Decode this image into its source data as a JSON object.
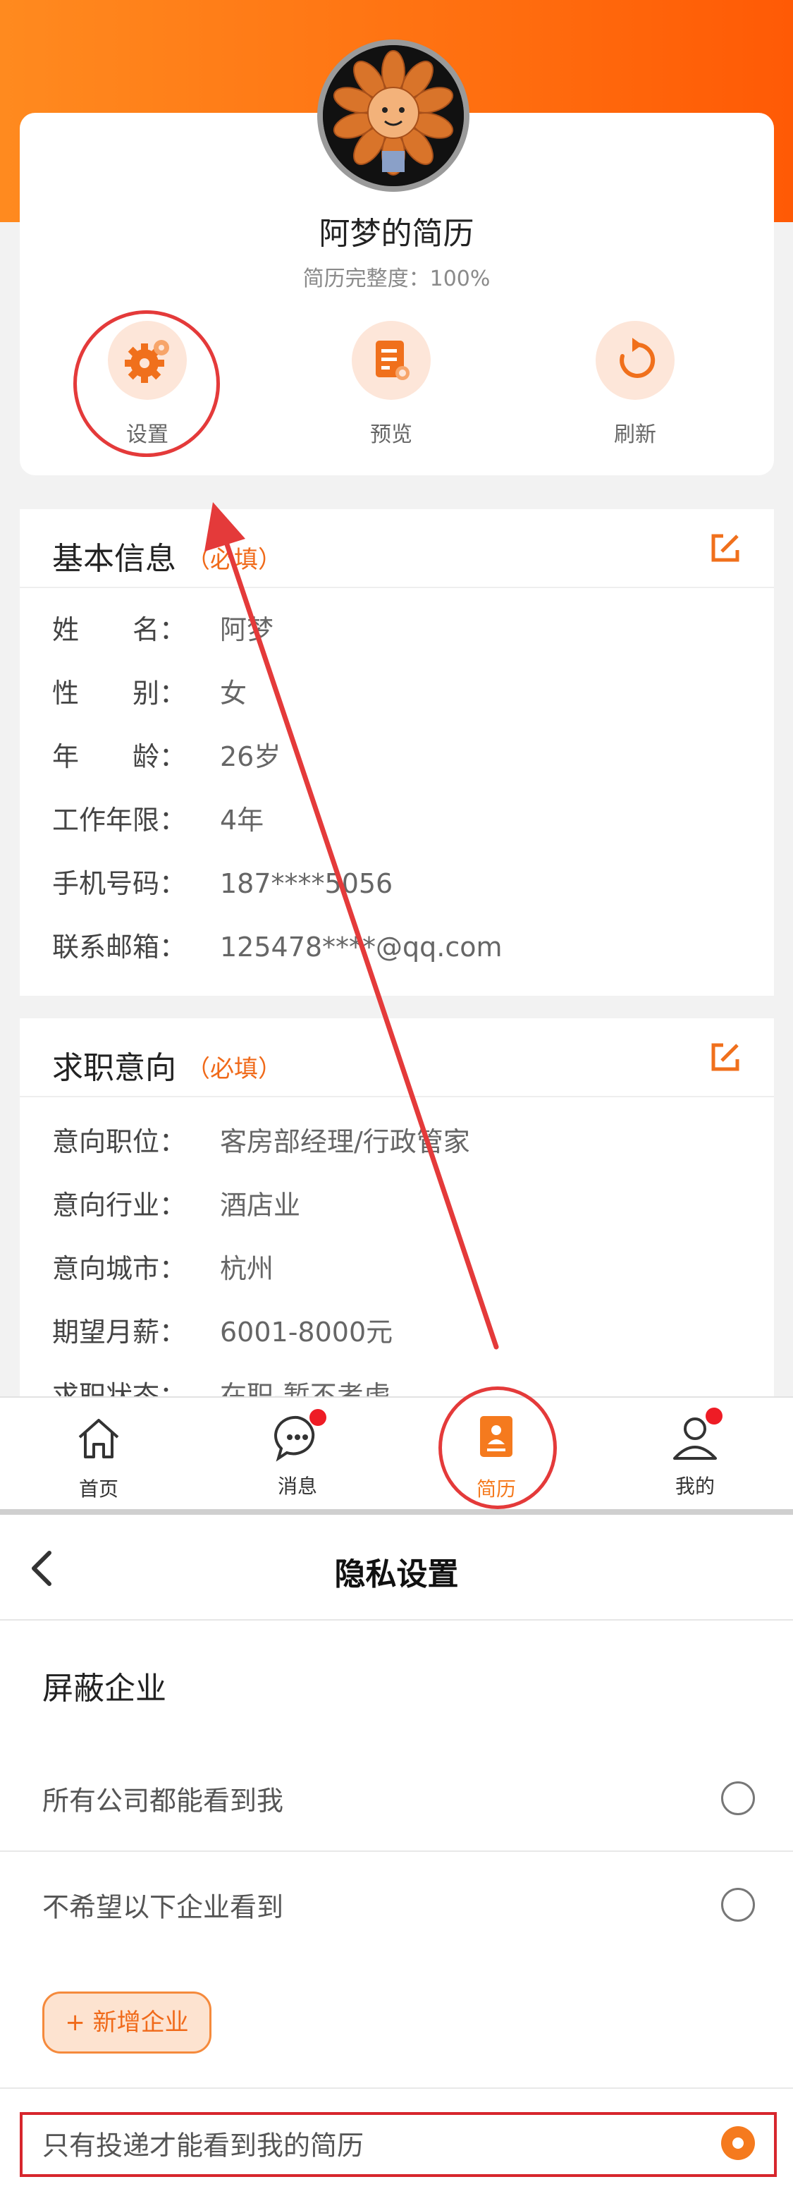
{
  "profile": {
    "title": "阿梦的简历",
    "completeness": "简历完整度：100%",
    "actions": [
      {
        "label": "设置",
        "icon": "settings-gear-icon"
      },
      {
        "label": "预览",
        "icon": "document-preview-icon"
      },
      {
        "label": "刷新",
        "icon": "refresh-icon"
      }
    ]
  },
  "basic_info": {
    "title": "基本信息",
    "required": "（必填）",
    "fields": [
      {
        "key": "姓　　名：",
        "value": "阿梦"
      },
      {
        "key": "性　　别：",
        "value": "女"
      },
      {
        "key": "年　　龄：",
        "value": "26岁"
      },
      {
        "key": "工作年限：",
        "value": "4年"
      },
      {
        "key": "手机号码：",
        "value": "187****5056"
      },
      {
        "key": "联系邮箱：",
        "value": "125478****@qq.com"
      }
    ]
  },
  "job_intent": {
    "title": "求职意向",
    "required": "（必填）",
    "fields": [
      {
        "key": "意向职位：",
        "value": "客房部经理/行政管家"
      },
      {
        "key": "意向行业：",
        "value": "酒店业"
      },
      {
        "key": "意向城市：",
        "value": "杭州"
      },
      {
        "key": "期望月薪：",
        "value": "6001-8000元"
      },
      {
        "key": "求职状态：",
        "value": "在职-暂不考虑"
      }
    ]
  },
  "tabbar": {
    "tabs": [
      {
        "label": "首页",
        "icon": "home-icon"
      },
      {
        "label": "消息",
        "icon": "chat-bubble-icon"
      },
      {
        "label": "简历",
        "icon": "resume-icon"
      },
      {
        "label": "我的",
        "icon": "user-icon"
      }
    ],
    "active_tab": "简历"
  },
  "privacy": {
    "nav_title": "隐私设置",
    "block_title": "屏蔽企业",
    "options": [
      {
        "label": "所有公司都能看到我",
        "selected": false
      },
      {
        "label": "不希望以下企业看到",
        "selected": false
      },
      {
        "label": "只有投递才能看到我的简历",
        "selected": true
      }
    ],
    "add_button": "+ 新增企业"
  },
  "colors": {
    "accent": "#f57a1e",
    "header_gradient_start": "#ff8a1f",
    "header_gradient_end": "#ff5a05",
    "badge": "#ee1c25",
    "annotation": "#e43a3a"
  }
}
